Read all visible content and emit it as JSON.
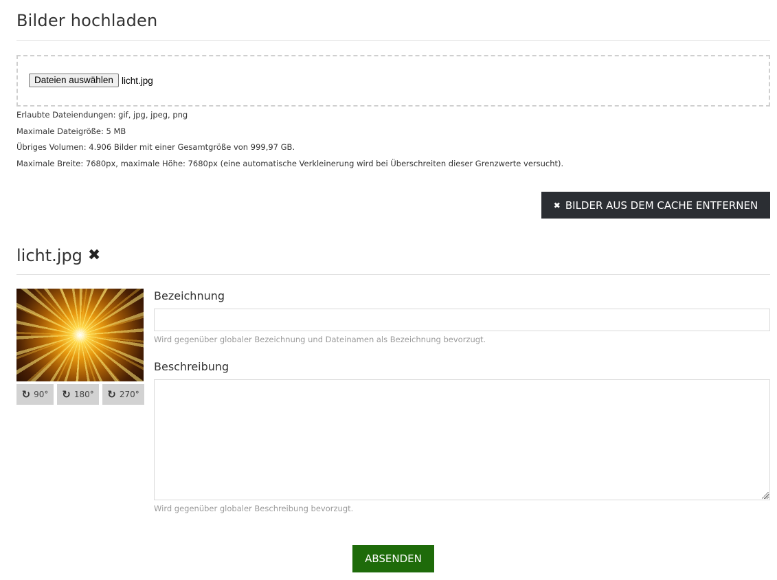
{
  "upload": {
    "title": "Bilder hochladen",
    "file_button_label": "Dateien auswählen",
    "selected_file": "licht.jpg",
    "info": [
      "Erlaubte Dateiendungen: gif, jpg, jpeg, png",
      "Maximale Dateigröße: 5 MB",
      "Übriges Volumen: 4.906 Bilder mit einer Gesamtgröße von 999,97 GB.",
      "Maximale Breite: 7680px, maximale Höhe: 7680px (eine automatische Verkleinerung wird bei Überschreiten dieser Grenzwerte versucht)."
    ],
    "cache_button_label": "Bilder aus dem Cache entfernen",
    "cache_button_icon": "close-icon"
  },
  "image": {
    "filename": "licht.jpg",
    "remove_icon": "close-icon",
    "rotate_buttons": [
      "90°",
      "180°",
      "270°"
    ],
    "rotate_icon": "rotate-clockwise-icon",
    "designation_label": "Bezeichnung",
    "designation_value": "",
    "designation_hint": "Wird gegenüber globaler Bezeichnung und Dateinamen als Bezeichnung bevorzugt.",
    "description_label": "Beschreibung",
    "description_value": "",
    "description_hint": "Wird gegenüber globaler Beschreibung bevorzugt."
  },
  "submit_label": "Absenden",
  "colors": {
    "cache_button_bg": "#2b2e33",
    "submit_button_bg": "#1e6b0a",
    "rotate_button_bg": "#d2d2d2"
  }
}
